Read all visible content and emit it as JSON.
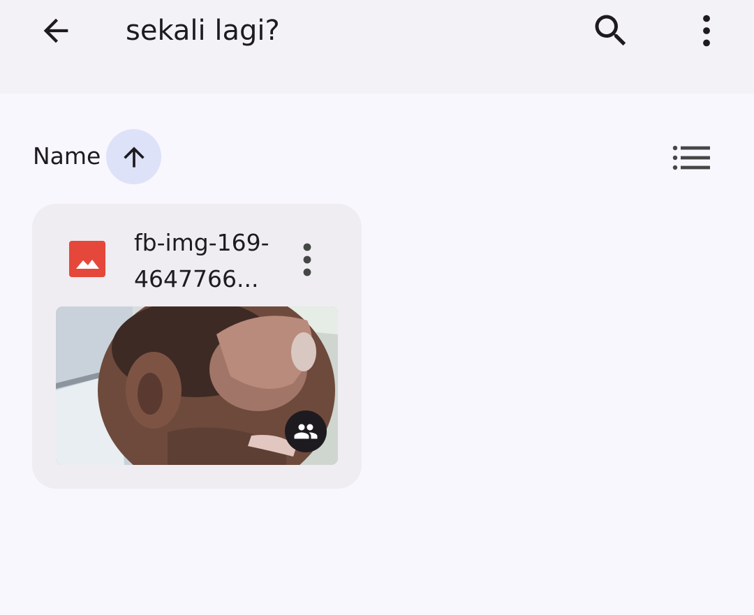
{
  "header": {
    "title": "sekali lagi?",
    "back_icon": "arrow-back-icon",
    "search_icon": "search-icon",
    "more_icon": "more-vert-icon",
    "background": "#f3f2f7"
  },
  "sort_bar": {
    "label": "Name",
    "direction_icon": "arrow-upward-icon",
    "direction": "ascending",
    "view_toggle_icon": "list-view-icon",
    "accent": "#dde2f8"
  },
  "files": [
    {
      "name": "fb-img-169­4647766...",
      "type_icon": "image-file-icon",
      "type_color": "#e5473a",
      "more_icon": "more-vert-icon",
      "thumbnail": "photo-thumbnail",
      "shared": true,
      "shared_icon": "people-icon"
    }
  ]
}
